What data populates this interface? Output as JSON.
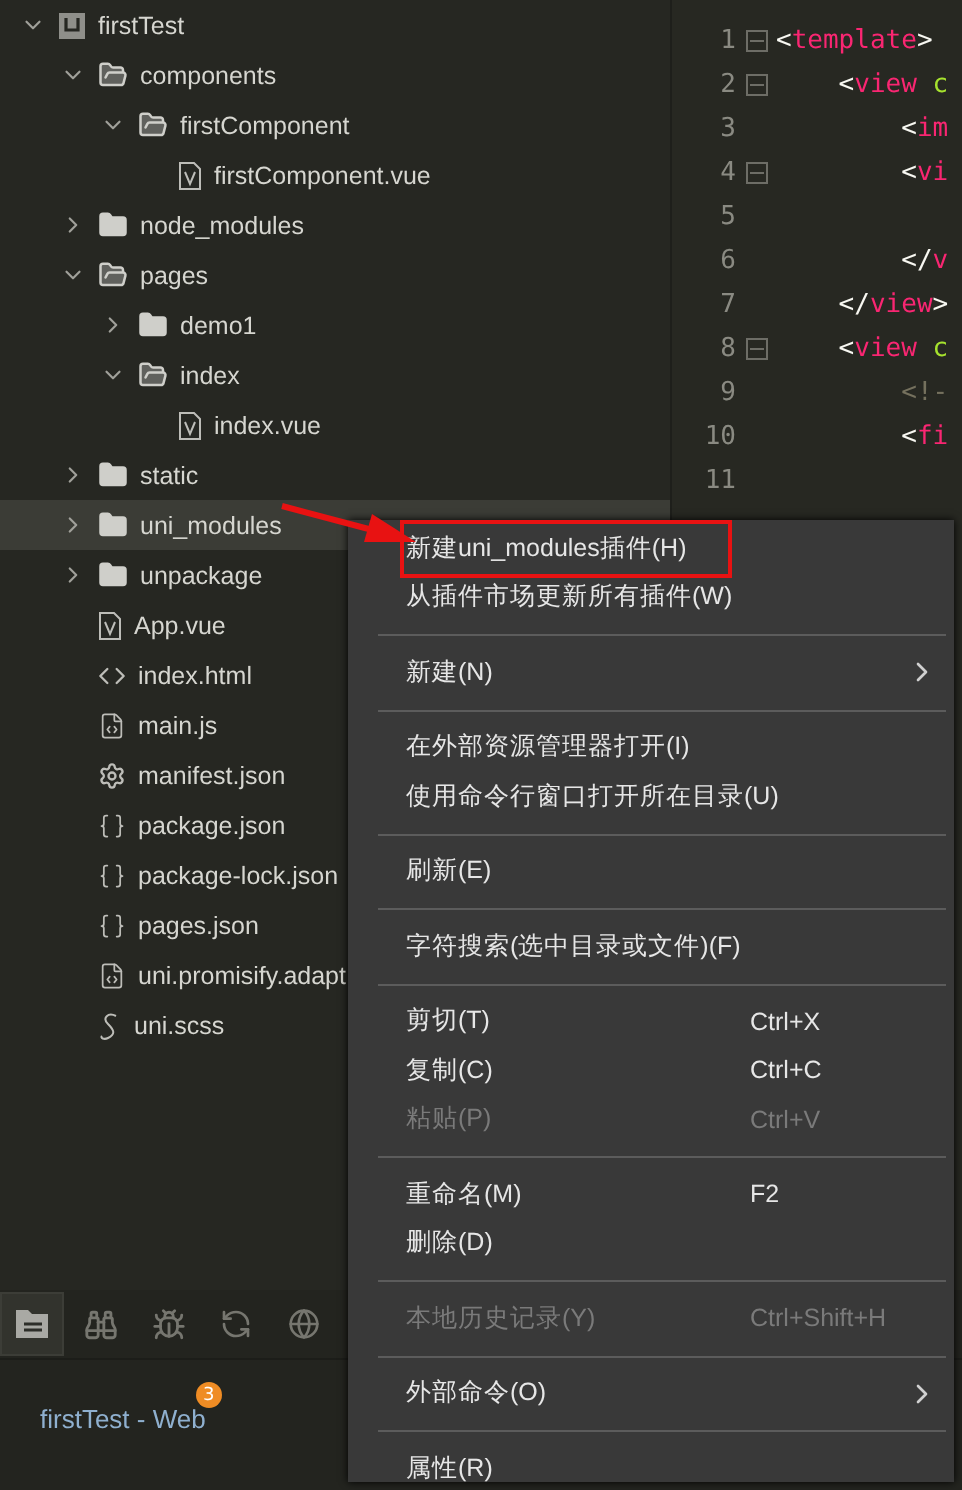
{
  "tree": [
    {
      "label": "firstTest",
      "kind": "project",
      "expanded": true,
      "selected": false,
      "children": [
        {
          "label": "components",
          "kind": "folder",
          "expanded": true,
          "selected": false,
          "children": [
            {
              "label": "firstComponent",
              "kind": "folder",
              "expanded": true,
              "selected": false,
              "children": [
                {
                  "label": "firstComponent.vue",
                  "kind": "vue",
                  "selected": false
                }
              ]
            }
          ]
        },
        {
          "label": "node_modules",
          "kind": "folder",
          "expanded": false,
          "selected": false
        },
        {
          "label": "pages",
          "kind": "folder",
          "expanded": true,
          "selected": false,
          "children": [
            {
              "label": "demo1",
              "kind": "folder",
              "expanded": false,
              "selected": false
            },
            {
              "label": "index",
              "kind": "folder",
              "expanded": true,
              "selected": false,
              "children": [
                {
                  "label": "index.vue",
                  "kind": "vue",
                  "selected": false
                }
              ]
            }
          ]
        },
        {
          "label": "static",
          "kind": "folder",
          "expanded": false,
          "selected": false
        },
        {
          "label": "uni_modules",
          "kind": "folder",
          "expanded": false,
          "selected": true
        },
        {
          "label": "unpackage",
          "kind": "folder",
          "expanded": false,
          "selected": false
        },
        {
          "label": "App.vue",
          "kind": "vue",
          "selected": false
        },
        {
          "label": "index.html",
          "kind": "html",
          "selected": false
        },
        {
          "label": "main.js",
          "kind": "js",
          "selected": false
        },
        {
          "label": "manifest.json",
          "kind": "settings",
          "selected": false
        },
        {
          "label": "package.json",
          "kind": "json",
          "selected": false
        },
        {
          "label": "package-lock.json",
          "kind": "json",
          "selected": false
        },
        {
          "label": "pages.json",
          "kind": "json",
          "selected": false
        },
        {
          "label": "uni.promisify.adapt",
          "kind": "js",
          "selected": false
        },
        {
          "label": "uni.scss",
          "kind": "style",
          "selected": false
        }
      ]
    }
  ],
  "editor": {
    "lines": [
      {
        "number": "1",
        "fold": true,
        "tokens": [
          {
            "kind": "punct",
            "text": "<"
          },
          {
            "kind": "tag",
            "text": "template"
          },
          {
            "kind": "punct",
            "text": ">"
          }
        ]
      },
      {
        "number": "2",
        "fold": true,
        "tokens": [
          {
            "kind": "punct",
            "text": "    <"
          },
          {
            "kind": "tag",
            "text": "view"
          },
          {
            "kind": "attr",
            "text": " c"
          }
        ]
      },
      {
        "number": "3",
        "fold": false,
        "tokens": [
          {
            "kind": "punct",
            "text": "        <"
          },
          {
            "kind": "tag",
            "text": "im"
          }
        ]
      },
      {
        "number": "4",
        "fold": true,
        "tokens": [
          {
            "kind": "punct",
            "text": "        <"
          },
          {
            "kind": "tag",
            "text": "vi"
          }
        ]
      },
      {
        "number": "5",
        "fold": false
      },
      {
        "number": "6",
        "fold": false,
        "tokens": [
          {
            "kind": "punct",
            "text": "        </"
          },
          {
            "kind": "tag",
            "text": "v"
          }
        ]
      },
      {
        "number": "7",
        "fold": false,
        "tokens": [
          {
            "kind": "punct",
            "text": "    </"
          },
          {
            "kind": "tag",
            "text": "view"
          },
          {
            "kind": "punct",
            "text": ">"
          }
        ]
      },
      {
        "number": "8",
        "fold": true,
        "tokens": [
          {
            "kind": "punct",
            "text": "    <"
          },
          {
            "kind": "tag",
            "text": "view"
          },
          {
            "kind": "attr",
            "text": " c"
          }
        ]
      },
      {
        "number": "9",
        "fold": false,
        "tokens": [
          {
            "kind": "comment",
            "text": "        <!-"
          }
        ]
      },
      {
        "number": "10",
        "fold": false,
        "tokens": [
          {
            "kind": "punct",
            "text": "        <"
          },
          {
            "kind": "tag",
            "text": "fi"
          }
        ]
      },
      {
        "number": "11",
        "fold": false
      }
    ]
  },
  "panel_tabs": [
    {
      "selected": true
    },
    {
      "selected": false
    },
    {
      "selected": false
    },
    {
      "selected": false
    },
    {
      "selected": false
    }
  ],
  "console_tab": {
    "label": "firstTest - Web",
    "badge": "3"
  },
  "context_menu": [
    {
      "kind": "item",
      "label": "新建uni_modules插件(H)",
      "boxed": true,
      "disabled": false,
      "submenu": false
    },
    {
      "kind": "item",
      "label": "从插件市场更新所有插件(W)",
      "boxed": false,
      "disabled": false,
      "submenu": false
    },
    {
      "kind": "separator"
    },
    {
      "kind": "item",
      "label": "新建(N)",
      "boxed": false,
      "disabled": false,
      "submenu": true
    },
    {
      "kind": "separator"
    },
    {
      "kind": "item",
      "label": "在外部资源管理器打开(I)",
      "boxed": false,
      "disabled": false,
      "submenu": false
    },
    {
      "kind": "item",
      "label": "使用命令行窗口打开所在目录(U)",
      "boxed": false,
      "disabled": false,
      "submenu": false
    },
    {
      "kind": "separator"
    },
    {
      "kind": "item",
      "label": "刷新(E)",
      "boxed": false,
      "disabled": false,
      "submenu": false
    },
    {
      "kind": "separator"
    },
    {
      "kind": "item",
      "label": "字符搜索(选中目录或文件)(F)",
      "boxed": false,
      "disabled": false,
      "submenu": false
    },
    {
      "kind": "separator"
    },
    {
      "kind": "item",
      "label": "剪切(T)",
      "shortcut": "Ctrl+X",
      "boxed": false,
      "disabled": false,
      "submenu": false
    },
    {
      "kind": "item",
      "label": "复制(C)",
      "shortcut": "Ctrl+C",
      "boxed": false,
      "disabled": false,
      "submenu": false
    },
    {
      "kind": "item",
      "label": "粘贴(P)",
      "shortcut": "Ctrl+V",
      "boxed": false,
      "disabled": true,
      "submenu": false
    },
    {
      "kind": "separator"
    },
    {
      "kind": "item",
      "label": "重命名(M)",
      "shortcut": "F2",
      "boxed": false,
      "disabled": false,
      "submenu": false
    },
    {
      "kind": "item",
      "label": "删除(D)",
      "boxed": false,
      "disabled": false,
      "submenu": false
    },
    {
      "kind": "separator"
    },
    {
      "kind": "item",
      "label": "本地历史记录(Y)",
      "shortcut": "Ctrl+Shift+H",
      "boxed": false,
      "disabled": true,
      "submenu": false
    },
    {
      "kind": "separator"
    },
    {
      "kind": "item",
      "label": "外部命令(O)",
      "boxed": false,
      "disabled": false,
      "submenu": true
    },
    {
      "kind": "separator"
    },
    {
      "kind": "item",
      "label": "属性(R)",
      "boxed": false,
      "disabled": false,
      "submenu": false
    }
  ]
}
